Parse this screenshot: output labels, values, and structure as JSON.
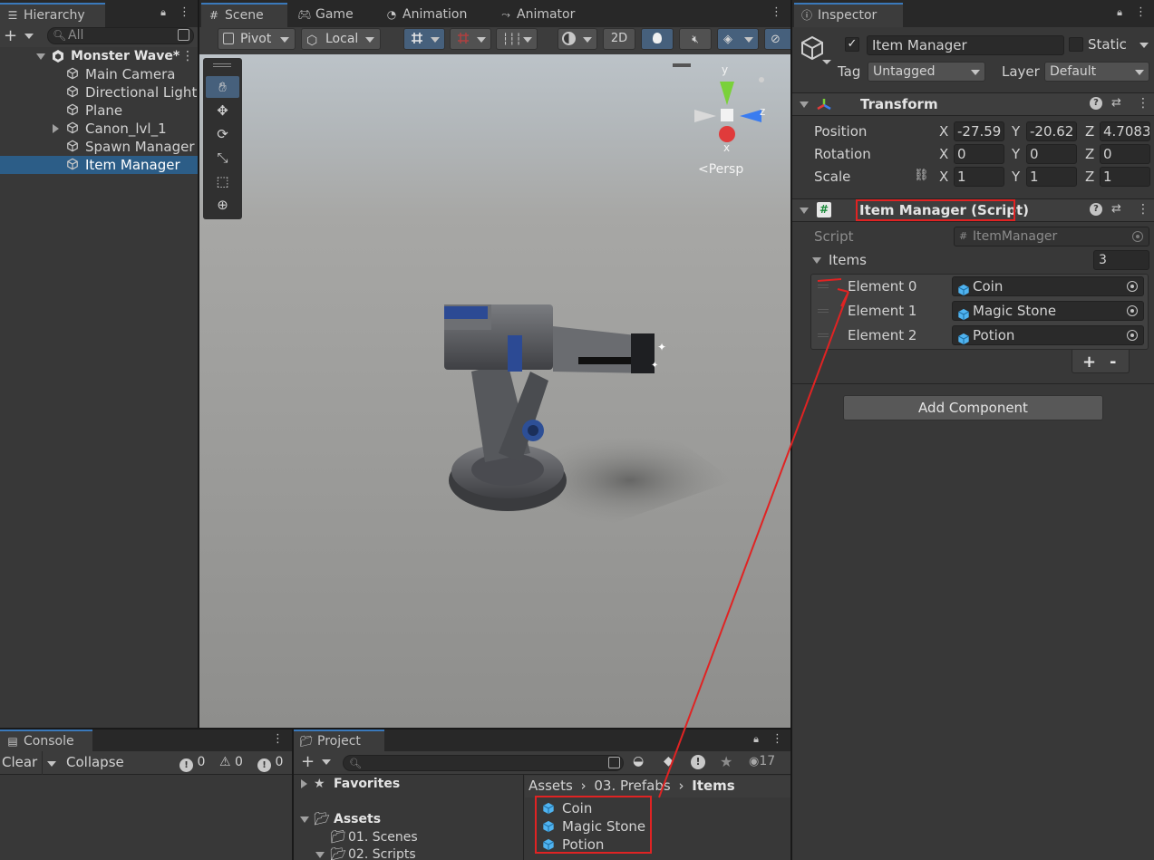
{
  "hierarchy": {
    "tab_label": "Hierarchy",
    "search_placeholder": "All",
    "scene_name": "Monster Wave*",
    "items": [
      {
        "label": "Main Camera",
        "expandable": false,
        "selected": false
      },
      {
        "label": "Directional Light",
        "expandable": false,
        "selected": false
      },
      {
        "label": "Plane",
        "expandable": false,
        "selected": false
      },
      {
        "label": "Canon_lvl_1",
        "expandable": true,
        "selected": false
      },
      {
        "label": "Spawn Manager",
        "expandable": false,
        "selected": false
      },
      {
        "label": "Item Manager",
        "expandable": false,
        "selected": true
      }
    ]
  },
  "scene": {
    "tabs": [
      "Scene",
      "Game",
      "Animation",
      "Animator"
    ],
    "toolbar": {
      "pivot_label": "Pivot",
      "local_label": "Local",
      "mode_2d_label": "2D"
    },
    "gizmo": {
      "y_label": "y",
      "x_label": "x",
      "z_label": "z",
      "persp_label": "<Persp"
    }
  },
  "inspector": {
    "tab_label": "Inspector",
    "object_name": "Item Manager",
    "active_checked": true,
    "static_label": "Static",
    "tag_label": "Tag",
    "tag_value": "Untagged",
    "layer_label": "Layer",
    "layer_value": "Default",
    "transform": {
      "title": "Transform",
      "position_label": "Position",
      "rotation_label": "Rotation",
      "scale_label": "Scale",
      "position": {
        "x": "-27.59",
        "y": "-20.62",
        "z": "4.7083"
      },
      "rotation": {
        "x": "0",
        "y": "0",
        "z": "0"
      },
      "scale": {
        "x": "1",
        "y": "1",
        "z": "1"
      }
    },
    "script_component": {
      "title": "Item Manager (Script)",
      "script_label": "Script",
      "script_value": "ItemManager",
      "items_label": "Items",
      "items_count": "3",
      "elements": [
        {
          "label": "Element 0",
          "value": "Coin"
        },
        {
          "label": "Element 1",
          "value": "Magic Stone"
        },
        {
          "label": "Element 2",
          "value": "Potion"
        }
      ],
      "add_label": "+",
      "remove_label": "-"
    },
    "add_component_label": "Add Component"
  },
  "console": {
    "tab_label": "Console",
    "clear_label": "Clear",
    "collapse_label": "Collapse",
    "info_count": "0",
    "warning_count": "0",
    "error_count": "0"
  },
  "project": {
    "tab_label": "Project",
    "hidden_count": "17",
    "tree": {
      "favorites_label": "Favorites",
      "assets_label": "Assets",
      "scenes_label": "01. Scenes",
      "scripts_label": "02. Scripts"
    },
    "breadcrumb": [
      "Assets",
      "03. Prefabs",
      "Items"
    ],
    "files": [
      "Coin",
      "Magic Stone",
      "Potion"
    ]
  },
  "colors": {
    "accent": "#3a79bb",
    "selection": "#2c5d87",
    "annotation": "#e02323",
    "prefab": "#4fb3f0"
  }
}
